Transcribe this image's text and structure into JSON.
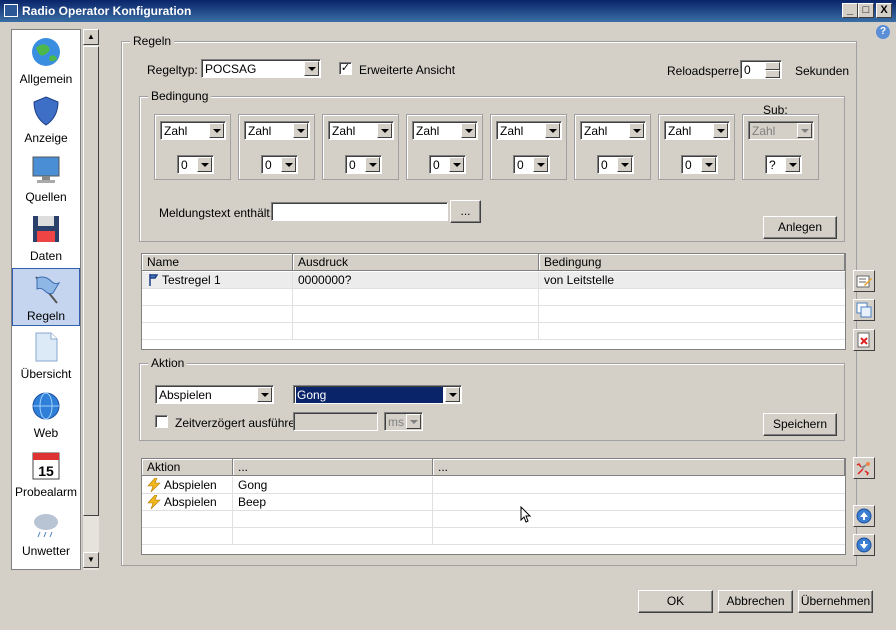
{
  "window": {
    "title": "Radio Operator Konfiguration",
    "minimize": "_",
    "maximize": "□",
    "close": "X",
    "help": "?"
  },
  "sidebar": {
    "items": [
      {
        "label": "Allgemein",
        "icon": "globe-icon"
      },
      {
        "label": "Anzeige",
        "icon": "shield-icon"
      },
      {
        "label": "Quellen",
        "icon": "monitor-icon"
      },
      {
        "label": "Daten",
        "icon": "floppy-disk-icon"
      },
      {
        "label": "Regeln",
        "icon": "flag-icon",
        "active": true
      },
      {
        "label": "Übersicht",
        "icon": "document-icon"
      },
      {
        "label": "Web",
        "icon": "web-globe-icon"
      },
      {
        "label": "Probealarm",
        "icon": "calendar-icon"
      },
      {
        "label": "Unwetter",
        "icon": "weather-cloud-icon"
      }
    ],
    "calendar_day": "15"
  },
  "regeln": {
    "legend": "Regeln",
    "regeltyp_label": "Regeltyp:",
    "regeltyp_value": "POCSAG",
    "erweiterte_label": "Erweiterte Ansicht",
    "erweiterte_checked": true,
    "check_mark": "✓",
    "reloadsperre_label": "Reloadsperre:",
    "reloadsperre_value": "0",
    "sekunden_label": "Sekunden"
  },
  "bedingung": {
    "legend": "Bedingung",
    "sub_label": "Sub:",
    "columns": [
      {
        "type": "Zahl",
        "value": "0"
      },
      {
        "type": "Zahl",
        "value": "0"
      },
      {
        "type": "Zahl",
        "value": "0"
      },
      {
        "type": "Zahl",
        "value": "0"
      },
      {
        "type": "Zahl",
        "value": "0"
      },
      {
        "type": "Zahl",
        "value": "0"
      },
      {
        "type": "Zahl",
        "value": "0"
      }
    ],
    "sub_column": {
      "type": "Zahl",
      "value": "?"
    },
    "meldungstext_label": "Meldungstext enthält:",
    "meldungstext_value": "",
    "browse_label": "...",
    "anlegen_label": "Anlegen"
  },
  "rules_table": {
    "headers": [
      "Name",
      "Ausdruck",
      "Bedingung"
    ],
    "rows": [
      {
        "name": "Testregel 1",
        "ausdruck": "0000000?",
        "bedingung": "von Leitstelle"
      }
    ]
  },
  "aktion": {
    "legend": "Aktion",
    "action_value": "Abspielen",
    "sound_value": "Gong",
    "delay_label": "Zeitverzögert ausführen",
    "delay_checked": false,
    "delay_value": "",
    "delay_unit": "ms",
    "speichern_label": "Speichern"
  },
  "actions_table": {
    "headers": [
      "Aktion",
      "...",
      "..."
    ],
    "rows": [
      {
        "aktion": "Abspielen",
        "param": "Gong"
      },
      {
        "aktion": "Abspielen",
        "param": "Beep"
      }
    ]
  },
  "footer": {
    "ok_label": "OK",
    "abbrechen_label": "Abbrechen",
    "uebernehmen_label": "Übernehmen"
  }
}
